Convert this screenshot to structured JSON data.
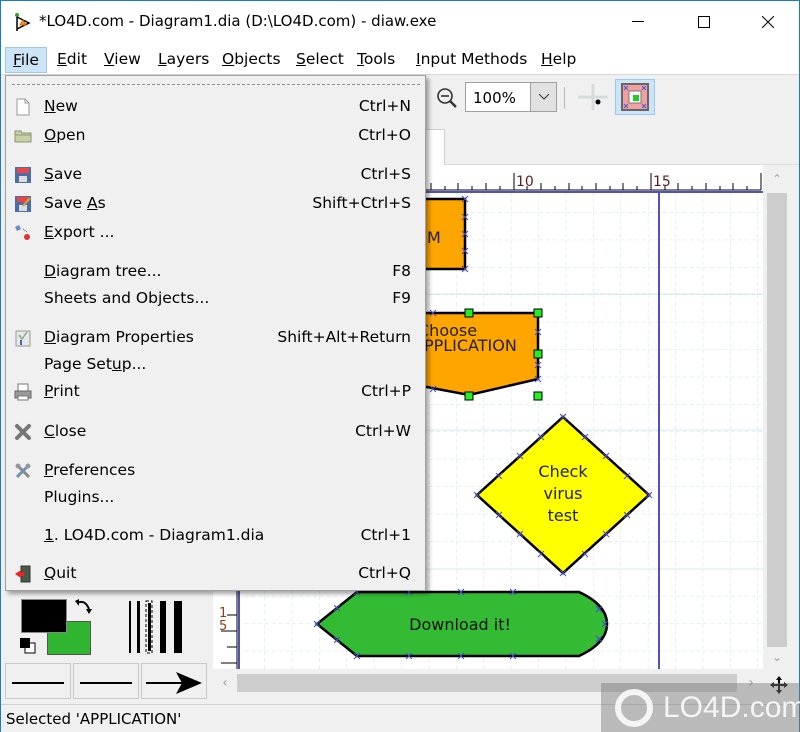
{
  "window": {
    "title": "*LO4D.com - Diagram1.dia (D:\\LO4D.com) - diaw.exe",
    "controls": {
      "minimize": "minimize",
      "maximize": "maximize",
      "close": "close"
    }
  },
  "menubar": [
    {
      "label": "File",
      "mnemonic": "F",
      "rest": "ile",
      "active": true
    },
    {
      "label": "Edit",
      "mnemonic": "E",
      "rest": "dit"
    },
    {
      "label": "View",
      "mnemonic": "V",
      "rest": "iew"
    },
    {
      "label": "Layers",
      "mnemonic": "L",
      "rest": "ayers"
    },
    {
      "label": "Objects",
      "mnemonic": "O",
      "rest": "bjects"
    },
    {
      "label": "Select",
      "mnemonic": "S",
      "rest": "elect"
    },
    {
      "label": "Tools",
      "mnemonic": "T",
      "rest": "ools"
    },
    {
      "label": "Input Methods",
      "mnemonic": "I",
      "rest": "nput Methods"
    },
    {
      "label": "Help",
      "mnemonic": "H",
      "rest": "elp"
    }
  ],
  "toolbar": {
    "zoom_value": "100%",
    "zoom_out_icon": "zoom-out-icon",
    "snap_grid_icon": "snap-to-grid-icon",
    "object_snap_icon": "object-snap-icon"
  },
  "file_menu": {
    "items": [
      {
        "pre": "",
        "u": "N",
        "post": "ew",
        "shortcut": "Ctrl+N",
        "icon": "new-file-icon"
      },
      {
        "pre": "",
        "u": "O",
        "post": "pen",
        "shortcut": "Ctrl+O",
        "icon": "open-folder-icon"
      },
      {
        "pre": "",
        "u": "S",
        "post": "ave",
        "shortcut": "Ctrl+S",
        "icon": "save-icon"
      },
      {
        "pre": "Save ",
        "u": "A",
        "post": "s",
        "shortcut": "Shift+Ctrl+S",
        "icon": "save-as-icon"
      },
      {
        "pre": "",
        "u": "E",
        "post": "xport ...",
        "shortcut": "",
        "icon": "export-icon"
      },
      {
        "pre": "",
        "u": "D",
        "post": "iagram tree...",
        "shortcut": "F8",
        "icon": ""
      },
      {
        "pre": "Sheets and Objects...",
        "u": "",
        "post": "",
        "shortcut": "F9",
        "icon": ""
      },
      {
        "pre": "",
        "u": "D",
        "post": "iagram Properties",
        "shortcut": "Shift+Alt+Return",
        "icon": "properties-icon"
      },
      {
        "pre": "Page Set",
        "u": "u",
        "post": "p...",
        "shortcut": "",
        "icon": ""
      },
      {
        "pre": "",
        "u": "P",
        "post": "rint",
        "shortcut": "Ctrl+P",
        "icon": "print-icon"
      },
      {
        "pre": "",
        "u": "C",
        "post": "lose",
        "shortcut": "Ctrl+W",
        "icon": "close-icon"
      },
      {
        "pre": "",
        "u": "P",
        "post": "references",
        "shortcut": "",
        "icon": "preferences-icon"
      },
      {
        "pre": "Plugins...",
        "u": "",
        "post": "",
        "shortcut": "",
        "icon": ""
      },
      {
        "pre": "",
        "u": "1",
        "post": ". LO4D.com - Diagram1.dia",
        "shortcut": "Ctrl+1",
        "icon": ""
      },
      {
        "pre": "",
        "u": "Q",
        "post": "uit",
        "shortcut": "Ctrl+Q",
        "icon": "quit-icon"
      }
    ]
  },
  "ruler": {
    "h_labels": [
      "10",
      "15"
    ],
    "v_labels": [
      "1",
      "5"
    ]
  },
  "diagram": {
    "shapes": [
      {
        "kind": "box",
        "text": "M",
        "fill": "#ffa500"
      },
      {
        "kind": "offpage",
        "text_line1": "Choose",
        "text_line2": "APPLICATION",
        "fill": "#ffa500",
        "selected": true
      },
      {
        "kind": "diamond",
        "text_line1": "Check",
        "text_line2": "virus",
        "text_line3": "test",
        "fill": "#ffff00"
      },
      {
        "kind": "display",
        "text": "Download it!",
        "fill": "#33bb33"
      }
    ]
  },
  "colors": {
    "foreground": "#000000",
    "background": "#2fb52f"
  },
  "statusbar": {
    "text": "Selected 'APPLICATION'"
  },
  "watermark": {
    "text": "LO4D.com"
  }
}
